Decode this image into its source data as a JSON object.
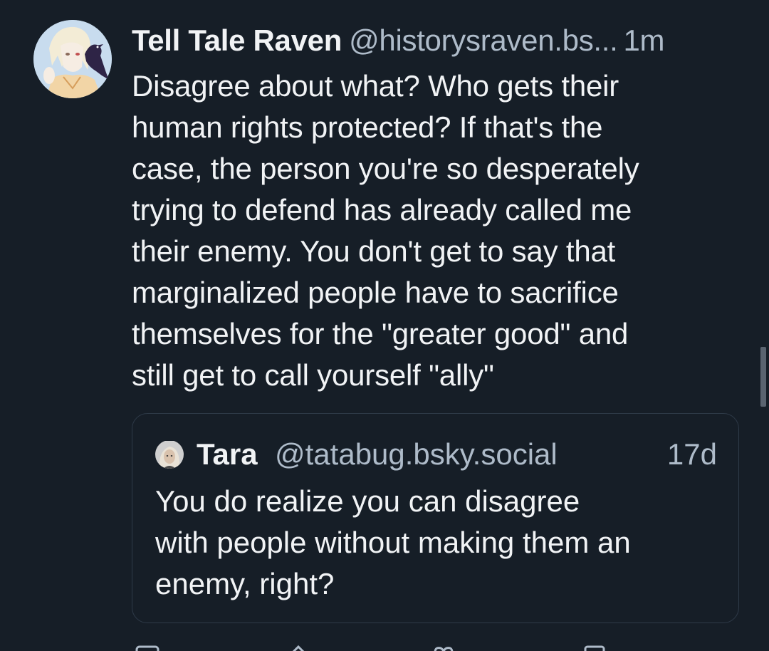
{
  "post": {
    "author": {
      "display_name": "Tell Tale Raven",
      "handle": "@historysraven.bs...",
      "avatar_icon": "illustrated-avatar-with-raven"
    },
    "timestamp": "1m",
    "text": "Disagree about what? Who gets their\nhuman rights protected? If that's the\ncase, the person you're so desperately\ntrying to defend has already called me\ntheir enemy. You don't get to say that\nmarginalized people have to sacrifice\nthemselves for the \"greater good\" and\nstill get to call yourself \"ally\"",
    "quote": {
      "author": {
        "display_name": "Tara",
        "handle": "@tatabug.bsky.social",
        "avatar_icon": "photo-avatar"
      },
      "timestamp": "17d",
      "text": "You do realize you can disagree\nwith people without making them an\nenemy, right?"
    },
    "actions": [
      "reply-icon",
      "repost-icon",
      "like-icon",
      "more-icon"
    ]
  },
  "colors": {
    "background": "#161e27",
    "text_primary": "#f1f3f5",
    "text_secondary": "#aebbc9",
    "border": "#2e3a48"
  }
}
